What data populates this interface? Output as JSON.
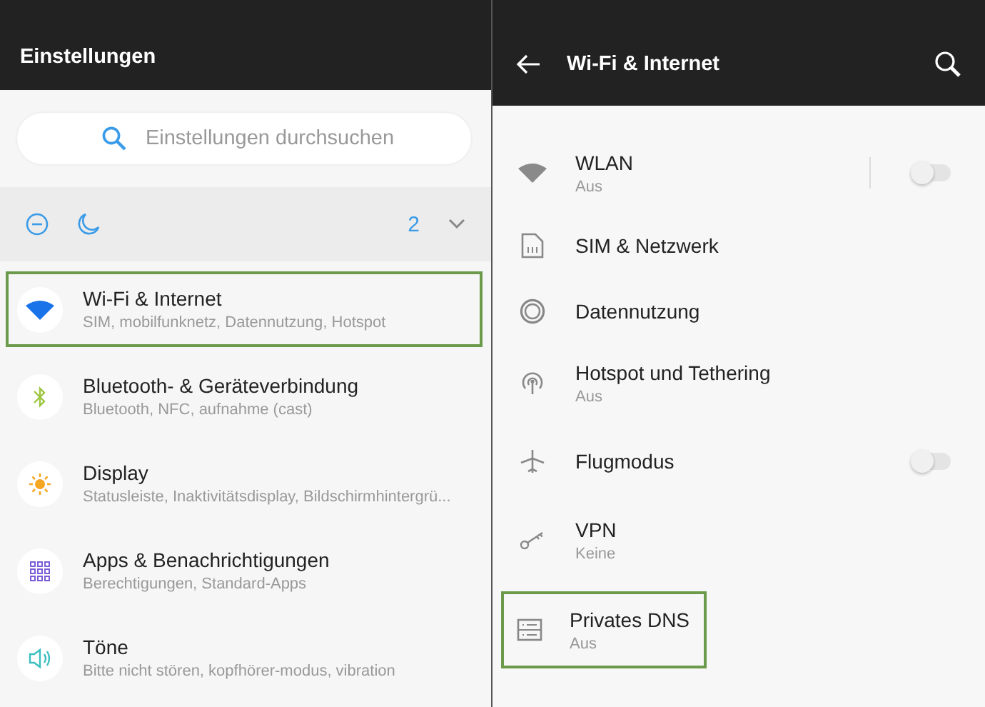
{
  "left": {
    "title": "Einstellungen",
    "search": {
      "placeholder": "Einstellungen durchsuchen"
    },
    "quick_bar": {
      "count": "2"
    },
    "items": [
      {
        "kind": "wifi",
        "title": "Wi-Fi & Internet",
        "subtitle": "SIM, mobilfunknetz, Datennutzung, Hotspot",
        "highlighted": true
      },
      {
        "kind": "bluetooth",
        "title": "Bluetooth- & Geräteverbindung",
        "subtitle": "Bluetooth, NFC, aufnahme (cast)",
        "highlighted": false
      },
      {
        "kind": "display",
        "title": "Display",
        "subtitle": "Statusleiste, Inaktivitätsdisplay, Bildschirmhintergrü...",
        "highlighted": false
      },
      {
        "kind": "apps",
        "title": "Apps & Benachrichtigungen",
        "subtitle": "Berechtigungen, Standard-Apps",
        "highlighted": false
      },
      {
        "kind": "sound",
        "title": "Töne",
        "subtitle": "Bitte nicht stören, kopfhörer-modus, vibration",
        "highlighted": false
      }
    ]
  },
  "right": {
    "title": "Wi-Fi & Internet",
    "items": [
      {
        "kind": "wifi",
        "title": "WLAN",
        "subtitle": "Aus",
        "toggle": {
          "on": false,
          "divider": true
        },
        "highlighted": false
      },
      {
        "kind": "sim",
        "title": "SIM & Netzwerk",
        "highlighted": false
      },
      {
        "kind": "data",
        "title": "Datennutzung",
        "highlighted": false
      },
      {
        "kind": "hotspot",
        "title": "Hotspot und Tethering",
        "subtitle": "Aus",
        "highlighted": false
      },
      {
        "kind": "plane",
        "title": "Flugmodus",
        "toggle": {
          "on": false,
          "divider": false
        },
        "highlighted": false
      },
      {
        "kind": "vpn",
        "title": "VPN",
        "subtitle": "Keine",
        "highlighted": false
      },
      {
        "kind": "dns",
        "title": "Privates DNS",
        "subtitle": "Aus",
        "highlighted": true
      }
    ]
  }
}
